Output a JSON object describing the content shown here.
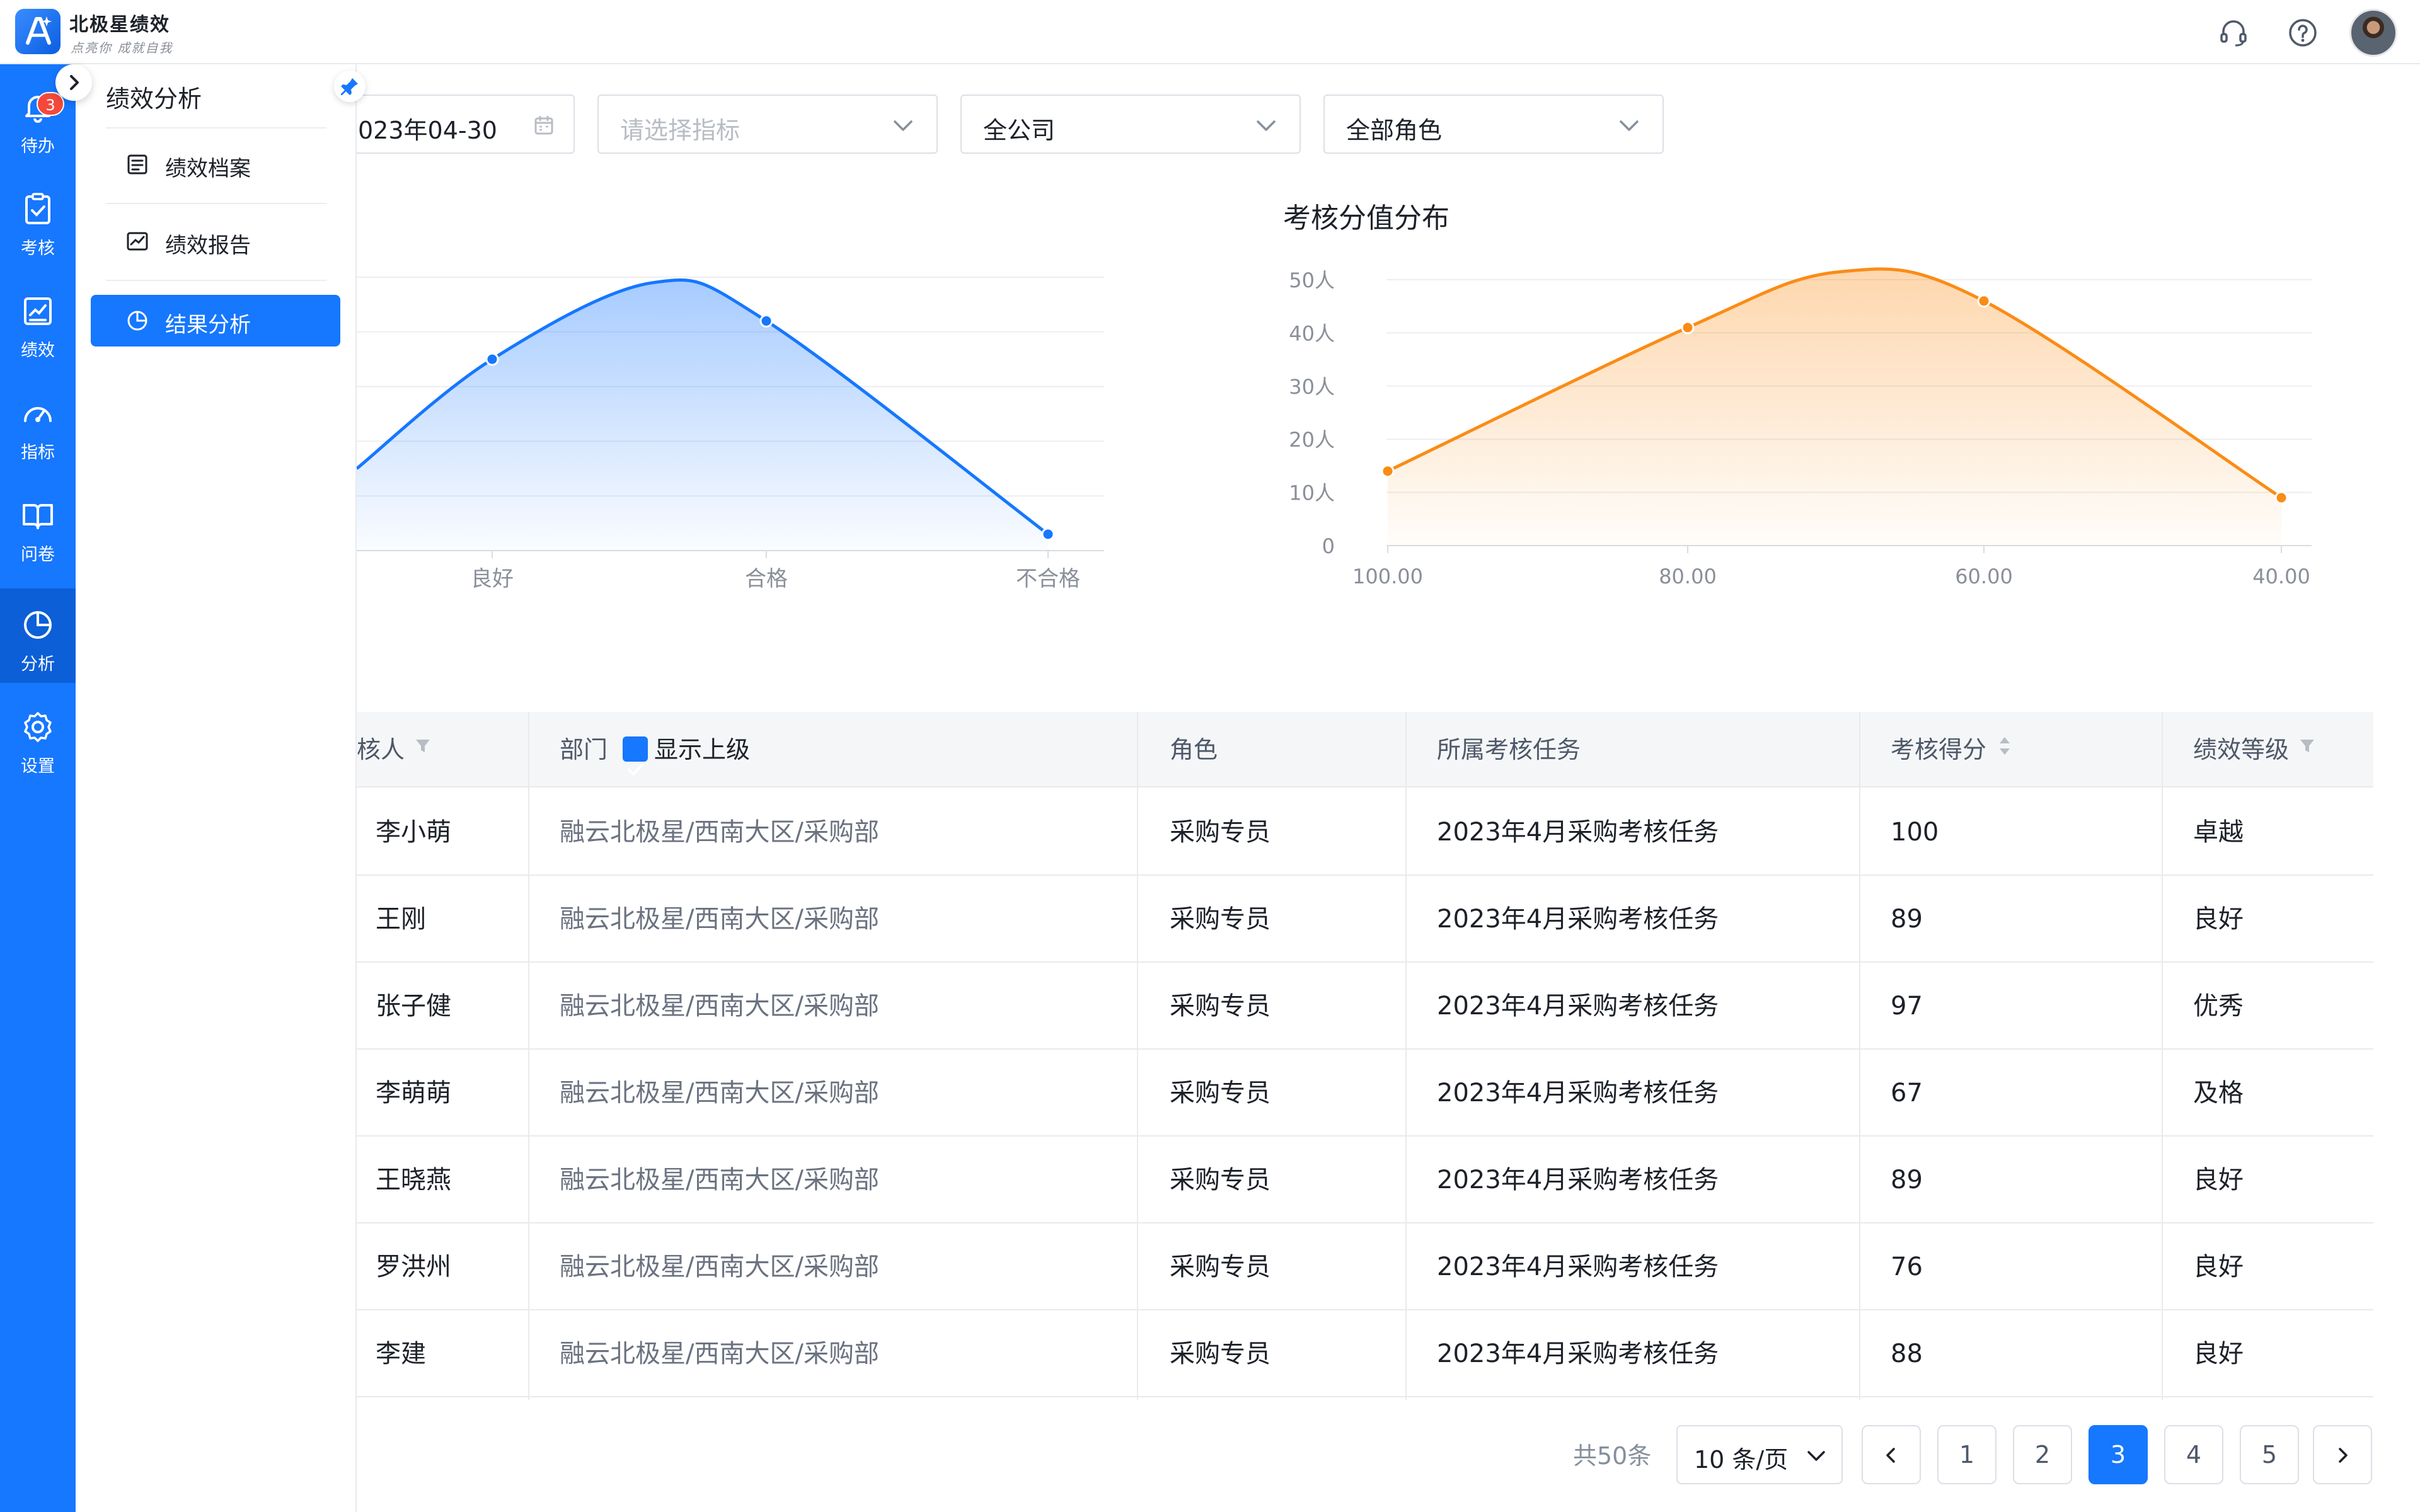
{
  "brand": {
    "name": "北极星绩效",
    "slogan": "点亮你 成就自我"
  },
  "header": {
    "icons": [
      "headset-icon",
      "help-icon"
    ],
    "avatar": "avatar"
  },
  "rail": {
    "items": [
      {
        "label": "待办",
        "icon": "bell-icon",
        "badge": "3"
      },
      {
        "label": "考核",
        "icon": "clipboard-check-icon"
      },
      {
        "label": "绩效",
        "icon": "chart-board-icon"
      },
      {
        "label": "指标",
        "icon": "gauge-icon"
      },
      {
        "label": "问卷",
        "icon": "book-icon"
      },
      {
        "label": "分析",
        "icon": "pie-chart-icon",
        "active": true
      },
      {
        "label": "设置",
        "icon": "gear-icon"
      }
    ]
  },
  "subnav": {
    "title": "绩效分析",
    "items": [
      {
        "label": "绩效档案",
        "icon": "archive-icon"
      },
      {
        "label": "绩效报告",
        "icon": "report-icon"
      },
      {
        "label": "结果分析",
        "icon": "pie-chart-icon",
        "active": true
      }
    ]
  },
  "filters": {
    "date": "023年04-30",
    "indicator_placeholder": "请选择指标",
    "scope": "全公司",
    "role": "全部角色"
  },
  "charts": {
    "left": {
      "title": "",
      "ticks": [
        "良好",
        "合格",
        "不合格"
      ]
    },
    "right": {
      "title": "考核分值分布",
      "yticks": [
        "50人",
        "40人",
        "30人",
        "20人",
        "10人",
        "0"
      ],
      "xticks": [
        "100.00",
        "80.00",
        "60.00",
        "40.00"
      ]
    }
  },
  "chart_data": [
    {
      "type": "area",
      "title": "",
      "categories": [
        "良好",
        "合格",
        "不合格"
      ],
      "series": [
        {
          "values": [
            35,
            42,
            3
          ]
        }
      ],
      "color": "#1677ff"
    },
    {
      "type": "area",
      "title": "考核分值分布",
      "x": [
        100,
        80,
        60,
        40
      ],
      "series": [
        {
          "values": [
            14,
            41,
            46,
            9
          ]
        }
      ],
      "ylim": [
        0,
        50
      ],
      "ylabel_unit": "人",
      "color": "#fa8c16"
    }
  ],
  "table": {
    "headers": {
      "person": "核人",
      "dept": "部门",
      "show_parent": "显示上级",
      "role": "角色",
      "task": "所属考核任务",
      "score": "考核得分",
      "grade": "绩效等级"
    },
    "rows": [
      {
        "name": "李小萌",
        "dept": "融云北极星/西南大区/采购部",
        "role": "采购专员",
        "task": "2023年4月采购考核任务",
        "score": "100",
        "grade": "卓越"
      },
      {
        "name": "王刚",
        "dept": "融云北极星/西南大区/采购部",
        "role": "采购专员",
        "task": "2023年4月采购考核任务",
        "score": "89",
        "grade": "良好"
      },
      {
        "name": "张子健",
        "dept": "融云北极星/西南大区/采购部",
        "role": "采购专员",
        "task": "2023年4月采购考核任务",
        "score": "97",
        "grade": "优秀"
      },
      {
        "name": "李萌萌",
        "dept": "融云北极星/西南大区/采购部",
        "role": "采购专员",
        "task": "2023年4月采购考核任务",
        "score": "67",
        "grade": "及格"
      },
      {
        "name": "王晓燕",
        "dept": "融云北极星/西南大区/采购部",
        "role": "采购专员",
        "task": "2023年4月采购考核任务",
        "score": "89",
        "grade": "良好"
      },
      {
        "name": "罗洪州",
        "dept": "融云北极星/西南大区/采购部",
        "role": "采购专员",
        "task": "2023年4月采购考核任务",
        "score": "76",
        "grade": "良好"
      },
      {
        "name": "李建",
        "dept": "融云北极星/西南大区/采购部",
        "role": "采购专员",
        "task": "2023年4月采购考核任务",
        "score": "88",
        "grade": "良好"
      }
    ]
  },
  "pagination": {
    "total": "共50条",
    "page_size": "10 条/页",
    "pages": [
      "1",
      "2",
      "3",
      "4",
      "5"
    ],
    "current": "3"
  }
}
